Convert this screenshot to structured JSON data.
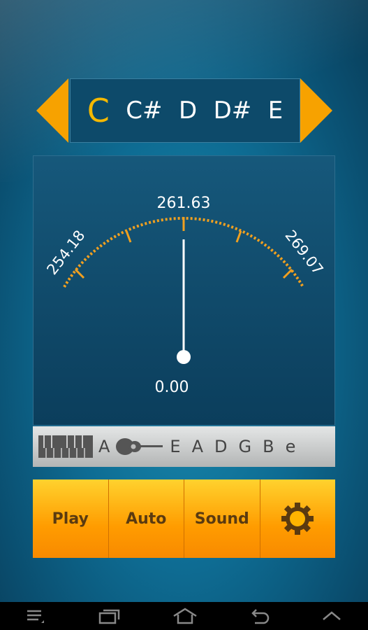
{
  "notes": {
    "items": [
      "C",
      "C#",
      "D",
      "D#",
      "E"
    ],
    "selected": "C"
  },
  "gauge": {
    "center_label": "261.63",
    "low_label": "254.18",
    "high_label": "269.07",
    "reading": "0.00"
  },
  "tuning_strip": {
    "reference": "A",
    "strings": [
      "E",
      "A",
      "D",
      "G",
      "B",
      "e"
    ]
  },
  "buttons": {
    "play": "Play",
    "auto": "Auto",
    "sound": "Sound"
  },
  "colors": {
    "accent": "#f7a200",
    "arc": "#f0a020"
  }
}
